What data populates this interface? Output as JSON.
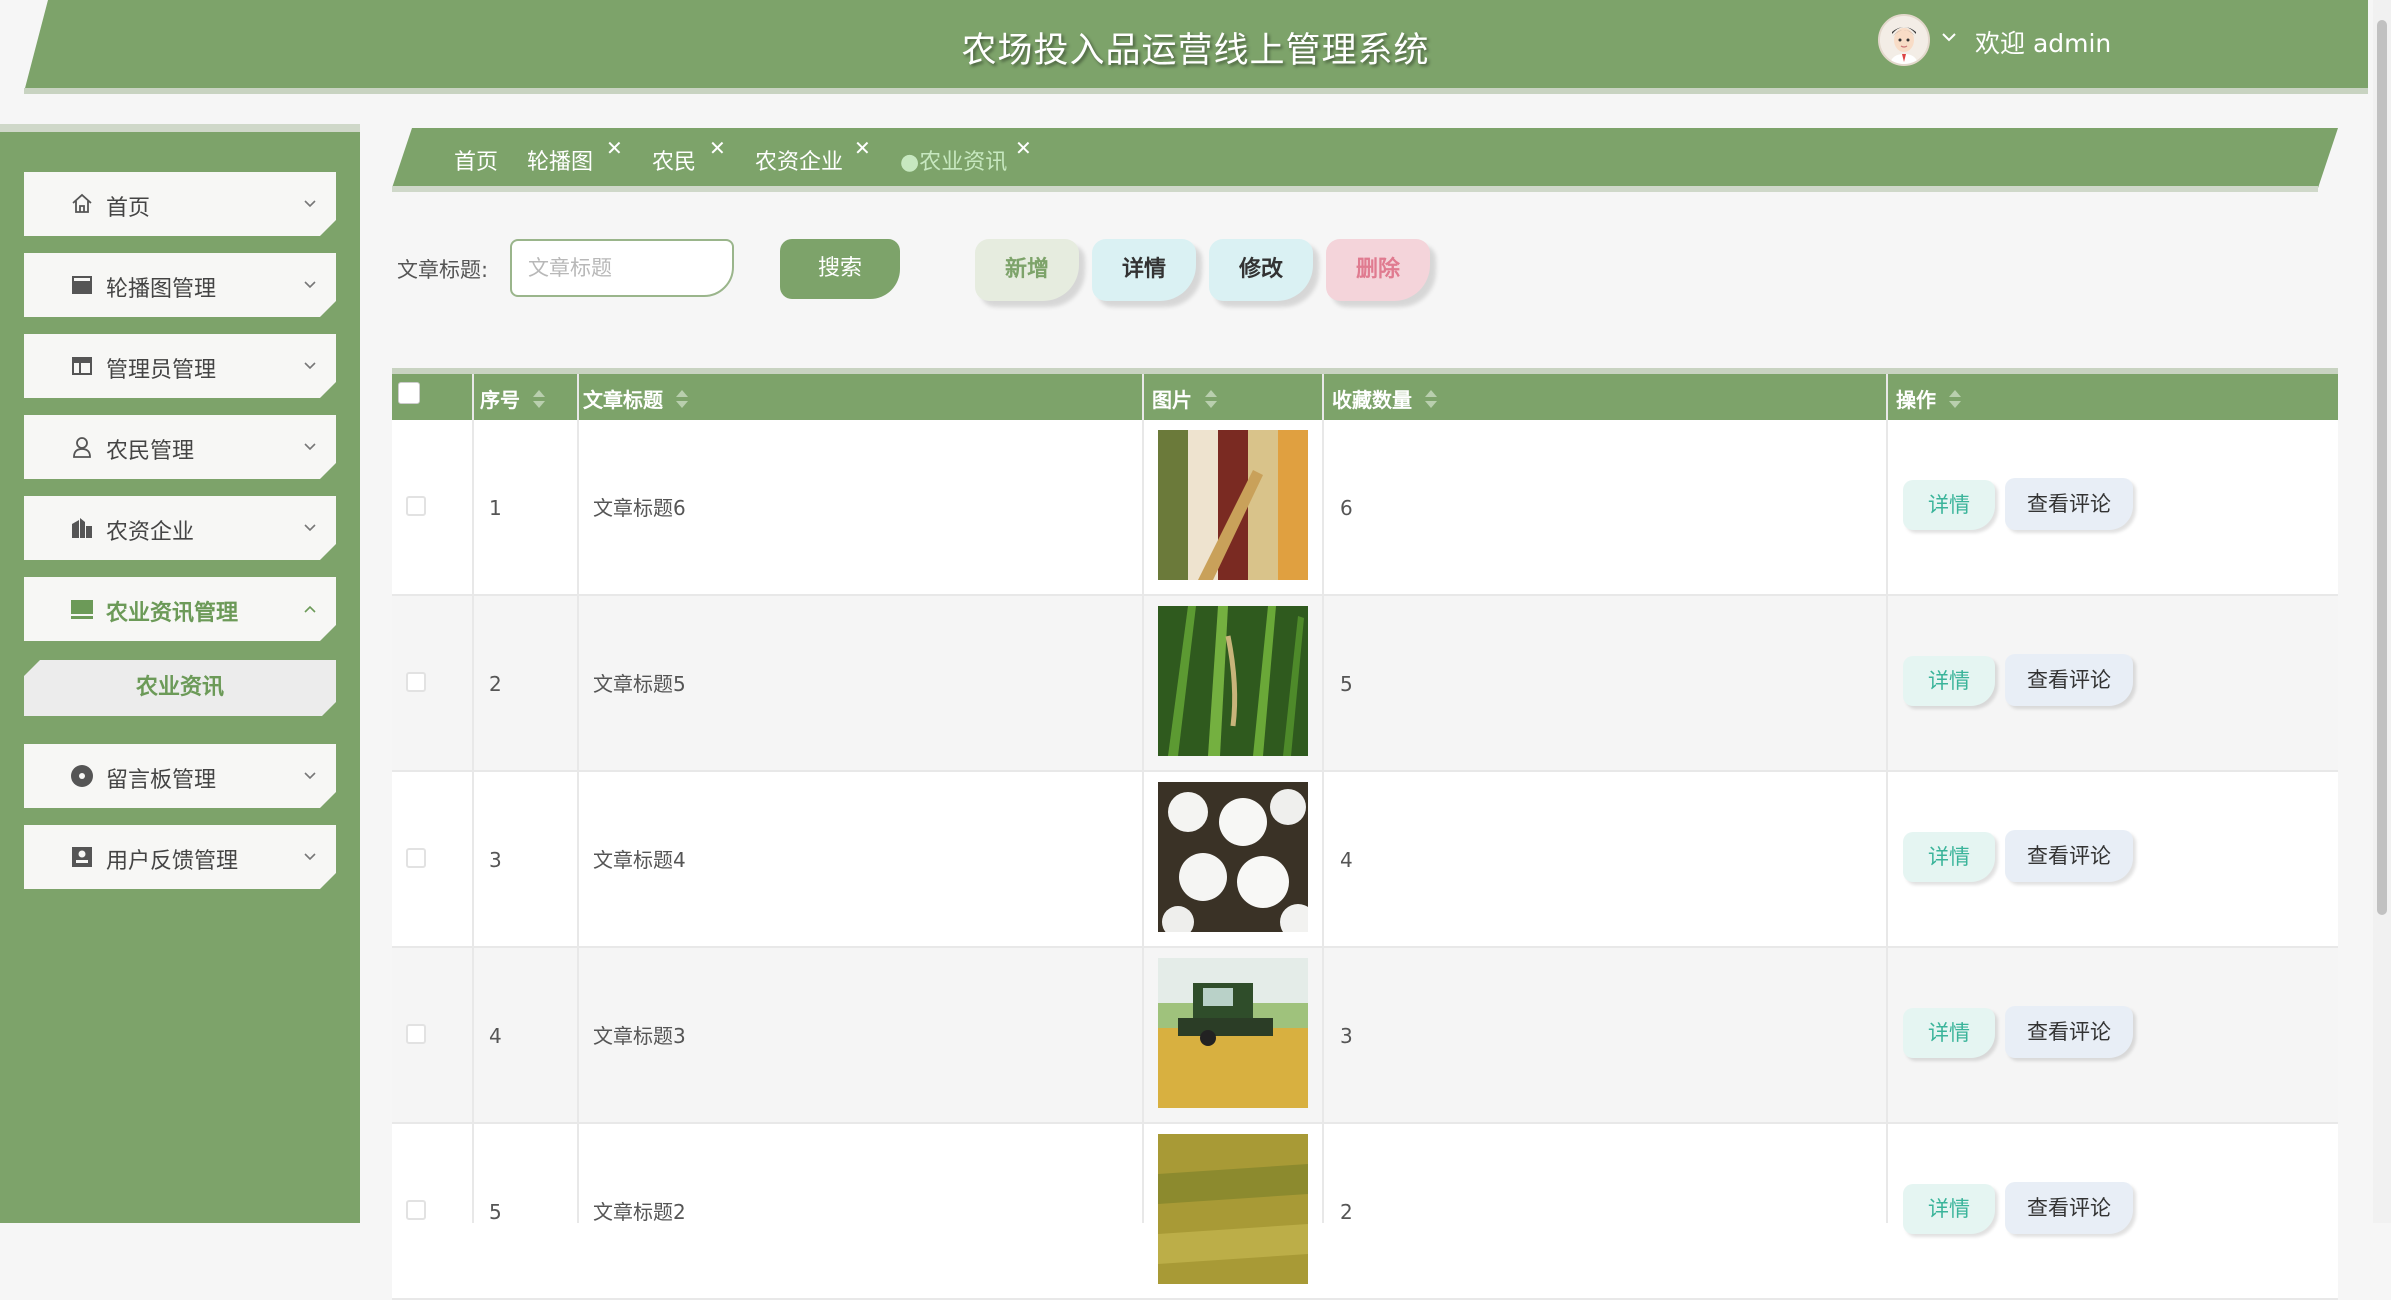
{
  "app": {
    "title": "农场投入品运营线上管理系统",
    "welcome": "欢迎 admin"
  },
  "colors": {
    "primary": "#7da36a",
    "light": "#e6ecdf",
    "danger": "#e07b90",
    "info": "#daf1f3"
  },
  "sidebar": {
    "items": [
      {
        "label": "首页",
        "icon": "home-icon",
        "expanded": false
      },
      {
        "label": "轮播图管理",
        "icon": "banner-icon",
        "expanded": false
      },
      {
        "label": "管理员管理",
        "icon": "admin-icon",
        "expanded": false
      },
      {
        "label": "农民管理",
        "icon": "user-icon",
        "expanded": false
      },
      {
        "label": "农资企业",
        "icon": "company-icon",
        "expanded": false
      },
      {
        "label": "农业资讯管理",
        "icon": "news-icon",
        "expanded": true
      },
      {
        "label": "留言板管理",
        "icon": "message-icon",
        "expanded": false
      },
      {
        "label": "用户反馈管理",
        "icon": "feedback-icon",
        "expanded": false
      }
    ],
    "submenu": {
      "label": "农业资讯"
    }
  },
  "tabs": [
    {
      "label": "首页",
      "closable": false
    },
    {
      "label": "轮播图",
      "closable": true
    },
    {
      "label": "农民",
      "closable": true
    },
    {
      "label": "农资企业",
      "closable": true
    },
    {
      "label": "●农业资讯",
      "closable": true,
      "active": true
    }
  ],
  "search": {
    "label": "文章标题:",
    "placeholder": "文章标题",
    "value": "",
    "button": "搜索"
  },
  "actions": {
    "add": "新增",
    "detail": "详情",
    "edit": "修改",
    "delete": "删除"
  },
  "table": {
    "headers": [
      "序号",
      "文章标题",
      "图片",
      "收藏数量",
      "操作"
    ],
    "rows": [
      {
        "index": "1",
        "title": "文章标题6",
        "image": "grains-photo",
        "favorites": "6"
      },
      {
        "index": "2",
        "title": "文章标题5",
        "image": "rice-plant-photo",
        "favorites": "5"
      },
      {
        "index": "3",
        "title": "文章标题4",
        "image": "cotton-photo",
        "favorites": "4"
      },
      {
        "index": "4",
        "title": "文章标题3",
        "image": "harvester-photo",
        "favorites": "3"
      },
      {
        "index": "5",
        "title": "文章标题2",
        "image": "wheat-field-photo",
        "favorites": "2"
      }
    ],
    "row_actions": {
      "detail": "详情",
      "comments": "查看评论"
    }
  }
}
